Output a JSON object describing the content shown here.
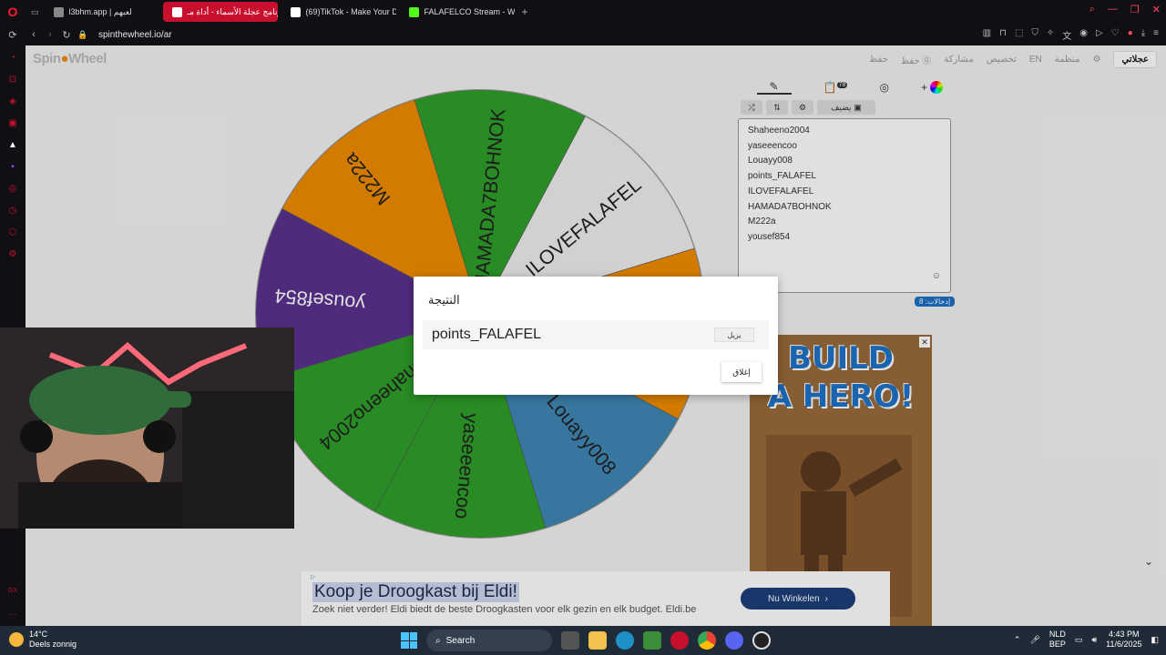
{
  "browser": {
    "tabs": [
      {
        "title": "l3bhm.app | لعبهم",
        "active": false,
        "favicon_color": "#888888"
      },
      {
        "title": "برنامج عجلة الأسماء - أداة مـ",
        "active": true,
        "favicon_color": "#ffffff"
      },
      {
        "title": "(69)TikTok - Make Your D",
        "active": false,
        "favicon_color": "#ffffff"
      },
      {
        "title": "FALAFELCO Stream - Wa",
        "active": false,
        "favicon_color": "#53fc18"
      }
    ],
    "url": "spinthewheel.io/ar"
  },
  "site": {
    "logo_left": "Spin",
    "logo_right": "Wheel",
    "nav": [
      "حفظ",
      "حفظ ⓪",
      "مشاركة",
      "تخصيص",
      "EN",
      "منظمة"
    ],
    "urgent": "عجلاتي"
  },
  "wheel": {
    "segments": [
      {
        "label": "ILOVEFALAFEL",
        "color": "#eeeeee",
        "text_color": "#222222"
      },
      {
        "label": "points_FALAFEL",
        "color": "#f08c00",
        "text_color": "#222222"
      },
      {
        "label": "Louayy008",
        "color": "#3f87b5",
        "text_color": "#222222"
      },
      {
        "label": "yaseeencoo",
        "color": "#2e9f2a",
        "text_color": "#222222"
      },
      {
        "label": "Shaheeno2004",
        "color": "#2e9f2a",
        "text_color": "#222222"
      },
      {
        "label": "yousef854",
        "color": "#5b3190",
        "text_color": "#ffffff"
      },
      {
        "label": "M222a",
        "color": "#f08c00",
        "text_color": "#222222"
      },
      {
        "label": "HAMADA7BOHNOK",
        "color": "#2e9f2a",
        "text_color": "#222222"
      }
    ]
  },
  "editor": {
    "tab_badge": "78",
    "buttons": {
      "shuffle": "⤮",
      "sort": "⇅",
      "settings": "⚙",
      "add_image": "يضيف"
    },
    "entries": [
      "Shaheeno2004",
      "yaseeencoo",
      "Louayy008",
      "points_FALAFEL",
      "ILOVEFALAFEL",
      "HAMADA7BOHNOK",
      "M222a",
      "yousef854"
    ],
    "count_label": "إدخالات: 8"
  },
  "dialog": {
    "title": "النتيجة",
    "result": "points_FALAFEL",
    "remove_label": "يزيل",
    "close_label": "إغلاق"
  },
  "ads": {
    "hero_line1": "BUILD",
    "hero_line2": "A HERO!",
    "bottom_headline": "Koop je Droogkast bij Eldi!",
    "bottom_desc": "Zoek niet verder! Eldi biedt de beste Droogkasten voor elk gezin en elk budget. Eldi.be",
    "bottom_cta": "Nu Winkelen"
  },
  "taskbar": {
    "temperature": "14°C",
    "weather": "Deels zonnig",
    "search": "Search",
    "lang1": "NLD",
    "lang2": "BEP",
    "time": "4:43 PM",
    "date": "11/6/2025"
  }
}
